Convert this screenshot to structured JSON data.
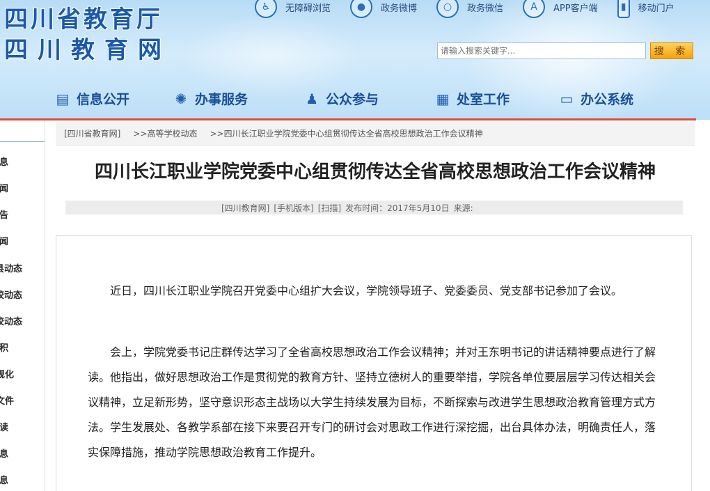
{
  "header": {
    "logo_line1": "四川省教育厅",
    "logo_line2": "四川教育网",
    "top_links": [
      {
        "icon": "accessibility-icon",
        "label": "无障碍浏览"
      },
      {
        "icon": "weibo-icon",
        "label": "政务微博"
      },
      {
        "icon": "wechat-icon",
        "label": "政务微信"
      },
      {
        "icon": "app-icon",
        "label": "APP客户端"
      },
      {
        "icon": "mobile-icon",
        "label": "移动门户"
      }
    ],
    "search": {
      "placeholder": "请输入搜索关键字...",
      "button_label": "搜 索"
    },
    "nav": [
      {
        "icon": "info-icon",
        "label": "信息公开"
      },
      {
        "icon": "service-icon",
        "label": "办事服务"
      },
      {
        "icon": "user-plus-icon",
        "label": "公众参与"
      },
      {
        "icon": "calendar-icon",
        "label": "处室工作"
      },
      {
        "icon": "monitor-icon",
        "label": "办公系统"
      }
    ],
    "accent_color": "#e04a36",
    "brand_color": "#1b5aa8"
  },
  "sidebar": {
    "items": [
      "息",
      "闻",
      "告",
      "闻",
      "县动态",
      "校动态",
      "校动态",
      "积",
      "规化",
      "文件",
      "读",
      "息",
      "息"
    ]
  },
  "breadcrumb": {
    "items": [
      "[四川省教育网]",
      ">>高等学校动态",
      ">>四川长江职业学院党委中心组贯彻传达全省高校思想政治工作会议精神"
    ]
  },
  "article": {
    "title": "四川长江职业学院党委中心组贯彻传达全省高校思想政治工作会议精神",
    "meta": {
      "source_site": "[四川教育网]",
      "mobile": "[手机版本]",
      "scan": "[扫描]",
      "publish_time": "发布时间：2017年5月10日",
      "source": "来源:"
    },
    "paragraphs": [
      "近日，四川长江职业学院召开党委中心组扩大会议，学院领导班子、党委委员、党支部书记参加了会议。",
      "会上，学院党委书记庄群传达学习了全省高校思想政治工作会议精神；并对王东明书记的讲话精神要点进行了解读。他指出，做好思想政治工作是贯彻党的教育方针、坚持立德树人的重要举措，学院各单位要层层学习传达相关会议精神，立足新形势，坚守意识形态主战场以大学生持续发展为目标，不断探索与改进学生思想政治教育管理方式方法。学生发展处、各教学系部在接下来要召开专门的研讨会对思政工作进行深挖掘，出台具体办法，明确责任人，落实保障措施，推动学院思想政治教育工作提升。"
    ]
  }
}
